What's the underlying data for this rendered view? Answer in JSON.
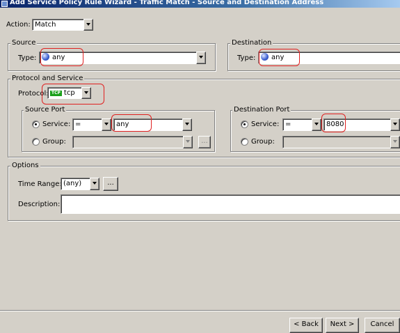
{
  "window": {
    "title": "Add Service Policy Rule Wizard - Traffic Match - Source and Destination Address"
  },
  "action": {
    "label": "Action:",
    "value": "Match"
  },
  "source": {
    "legend": "Source",
    "type_label": "Type:",
    "type_value": "any",
    "type_icon": "network-object-icon"
  },
  "destination": {
    "legend": "Destination",
    "type_label": "Type:",
    "type_value": "any",
    "type_icon": "network-object-icon"
  },
  "protocol_service": {
    "legend": "Protocol and Service",
    "protocol_label": "Protocol:",
    "protocol_badge": "TCP",
    "protocol_value": "tcp",
    "source_port": {
      "legend": "Source Port",
      "service_label": "Service:",
      "operator": "=",
      "service_value": "any",
      "group_label": "Group:",
      "browse_label": "..."
    },
    "destination_port": {
      "legend": "Destination Port",
      "service_label": "Service:",
      "operator": "=",
      "service_value": "8080",
      "group_label": "Group:"
    }
  },
  "options": {
    "legend": "Options",
    "time_range_label": "Time Range:",
    "time_range_value": "(any)",
    "browse_label": "...",
    "description_label": "Description:",
    "description_value": ""
  },
  "buttons": {
    "back": "< Back",
    "next": "Next >",
    "cancel": "Cancel"
  },
  "colors": {
    "highlight": "#e02020",
    "title_bar": "#0a246a",
    "dialog": "#d4d0c8"
  }
}
